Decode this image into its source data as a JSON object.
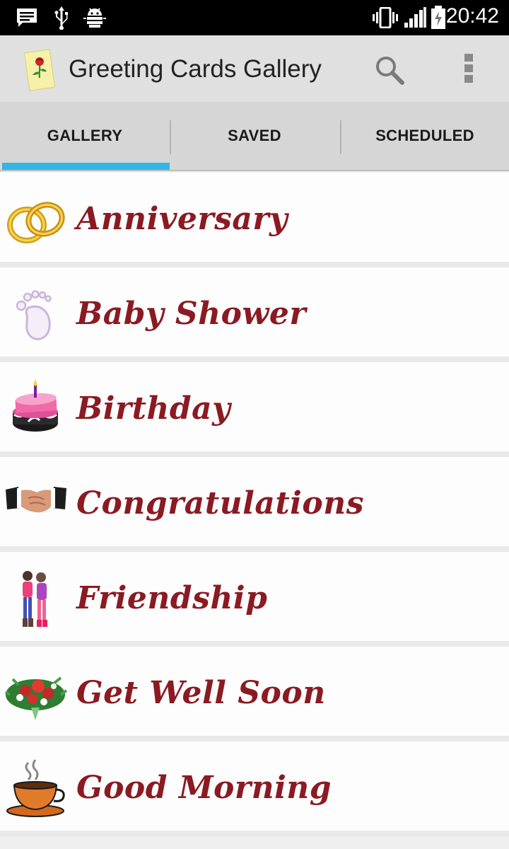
{
  "status_bar": {
    "time": "20:42",
    "left_icons": [
      "message-icon",
      "usb-icon",
      "android-debug-icon"
    ],
    "right_icons": [
      "vibrate-icon",
      "signal-icon",
      "battery-charging-icon"
    ]
  },
  "app_bar": {
    "title": "Greeting Cards Gallery",
    "logo_icon": "rose-card-icon",
    "actions": [
      "search-icon",
      "overflow-menu-icon"
    ]
  },
  "tabs": [
    {
      "label": "GALLERY",
      "selected": true
    },
    {
      "label": "SAVED",
      "selected": false
    },
    {
      "label": "SCHEDULED",
      "selected": false
    }
  ],
  "accent_color": "#33b5e5",
  "category_text_color": "#8b1a22",
  "categories": [
    {
      "label": "Anniversary",
      "icon": "wedding-rings-icon"
    },
    {
      "label": "Baby Shower",
      "icon": "baby-footprint-icon"
    },
    {
      "label": "Birthday",
      "icon": "birthday-cake-icon"
    },
    {
      "label": "Congratulations",
      "icon": "handshake-icon"
    },
    {
      "label": "Friendship",
      "icon": "friends-icon"
    },
    {
      "label": "Get Well Soon",
      "icon": "flower-bouquet-icon"
    },
    {
      "label": "Good Morning",
      "icon": "coffee-cup-icon"
    }
  ]
}
